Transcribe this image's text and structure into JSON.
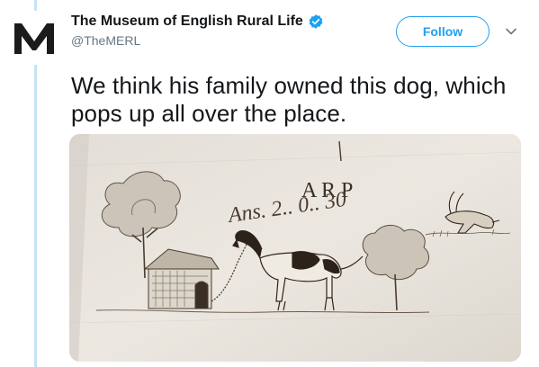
{
  "tweet": {
    "author": {
      "display_name": "The Museum of English Rural Life",
      "handle": "@TheMERL",
      "verified": true,
      "avatar_letter": "M"
    },
    "follow_label": "Follow",
    "text": "We think his family owned this dog, which pops up all over the place.",
    "media": {
      "alt_icon": "dog-drawing-image",
      "inscription_top": "A R P",
      "inscription_main": "Ans.  2.. 0.. 30"
    }
  },
  "colors": {
    "accent": "#1da1f2",
    "thread_line": "#c5e3f6",
    "text_primary": "#14171a",
    "text_secondary": "#657786",
    "paper": "#e9e5de",
    "ink": "#4a3b2e"
  }
}
